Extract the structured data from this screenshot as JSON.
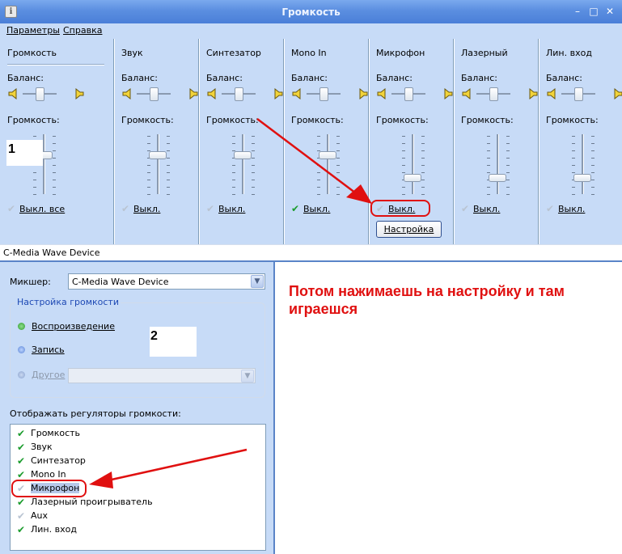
{
  "window": {
    "title": "Громкость",
    "app_icon": "i"
  },
  "menu": {
    "params": "Параметры",
    "help": "Справка"
  },
  "mixer": {
    "balance_label": "Баланс:",
    "volume_label": "Громкость:",
    "channels": [
      {
        "name": "Громкость",
        "mute": "Выкл. все",
        "checked": false,
        "level": 0.65
      },
      {
        "name": "Звук",
        "mute": "Выкл.",
        "checked": false,
        "level": 0.65
      },
      {
        "name": "Синтезатор",
        "mute": "Выкл.",
        "checked": false,
        "level": 0.65
      },
      {
        "name": "Mono In",
        "mute": "Выкл.",
        "checked": true,
        "level": 0.65
      },
      {
        "name": "Микрофон",
        "mute": "Выкл.",
        "checked": false,
        "level": 0.27
      },
      {
        "name": "Лазерный",
        "mute": "Выкл.",
        "checked": false,
        "level": 0.27
      },
      {
        "name": "Лин. вход",
        "mute": "Выкл.",
        "checked": false,
        "level": 0.27
      }
    ],
    "settings_button": "Настройка"
  },
  "device_bar": "C-Media Wave Device",
  "dialog": {
    "mixer_label": "Микшер:",
    "mixer_value": "C-Media Wave Device",
    "group_title": "Настройка громкости",
    "playback": "Воспроизведение",
    "record": "Запись",
    "other": "Другое",
    "show_label": "Отображать регуляторы громкости:",
    "items": [
      {
        "label": "Громкость",
        "checked": true
      },
      {
        "label": "Звук",
        "checked": true
      },
      {
        "label": "Синтезатор",
        "checked": true
      },
      {
        "label": "Mono In",
        "checked": true
      },
      {
        "label": "Микрофон",
        "checked": false
      },
      {
        "label": "Лазерный проигрыватель",
        "checked": true
      },
      {
        "label": "Aux",
        "checked": false
      },
      {
        "label": "Лин. вход",
        "checked": true
      }
    ]
  },
  "annotations": {
    "num1": "1",
    "num2": "2",
    "text": "Потом нажимаешь на настройку и там играешся",
    "color": "#e01010"
  }
}
